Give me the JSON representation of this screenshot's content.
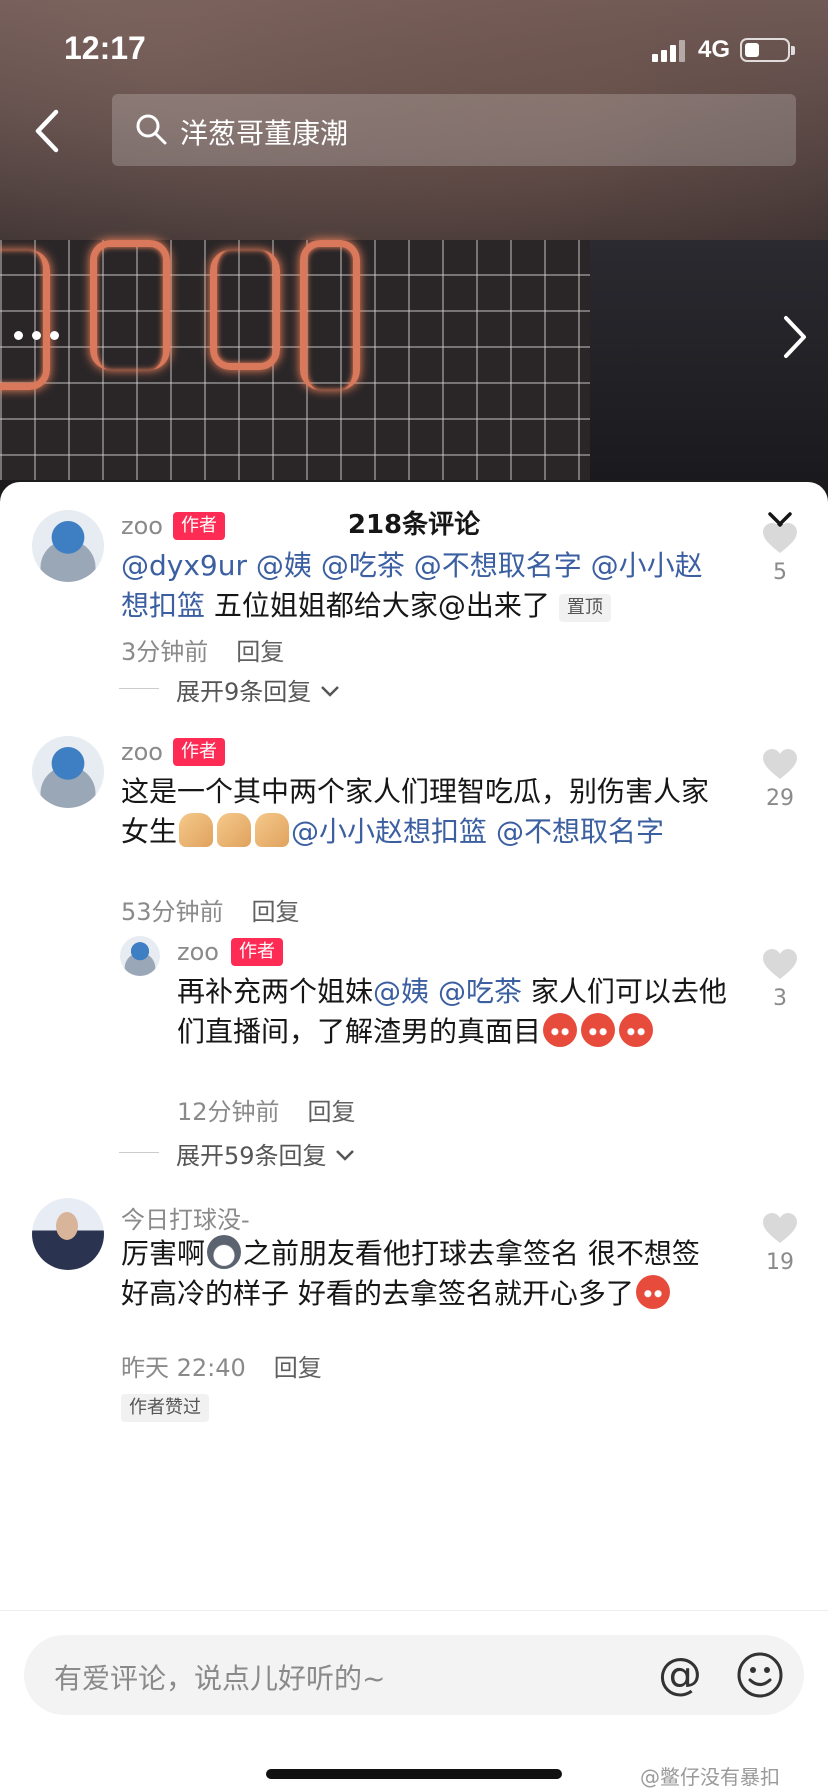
{
  "status": {
    "time": "12:17",
    "network": "4G"
  },
  "search": {
    "query": "洋葱哥董康潮"
  },
  "sheet": {
    "title": "218条评论"
  },
  "comments": [
    {
      "author": "zoo",
      "tag": "作者",
      "text_parts": [
        "@dyx9ur",
        "@姨",
        "@吃茶",
        "@不想取名字",
        "@小小赵想扣篮",
        "五位姐姐都给大家@出来了"
      ],
      "pin": "置顶",
      "time": "3分钟前",
      "reply_label": "回复",
      "likes": "5",
      "expand": "展开9条回复"
    },
    {
      "author": "zoo",
      "tag": "作者",
      "text": "这是一个其中两个家人们理智吃瓜，别伤害人家女生",
      "mentions": [
        "@小小赵想扣篮",
        "@不想取名字"
      ],
      "time": "53分钟前",
      "reply_label": "回复",
      "likes": "29"
    },
    {
      "author": "zoo",
      "tag": "作者",
      "text_pre": "再补充两个姐妹",
      "mentions": [
        "@姨",
        "@吃茶"
      ],
      "text_post": "家人们可以去他们直播间，了解渣男的真面目",
      "time": "12分钟前",
      "reply_label": "回复",
      "likes": "3",
      "expand": "展开59条回复"
    },
    {
      "author": "今日打球没-",
      "text_pre": "厉害啊",
      "text_post": "之前朋友看他打球去拿签名 很不想签好高冷的样子 好看的去拿签名就开心多了",
      "time": "昨天 22:40",
      "reply_label": "回复",
      "likes": "19",
      "liked_by_author": "作者赞过"
    }
  ],
  "input": {
    "placeholder": "有爱评论，说点儿好听的~"
  },
  "watermark": "@鳖仔没有暴扣"
}
